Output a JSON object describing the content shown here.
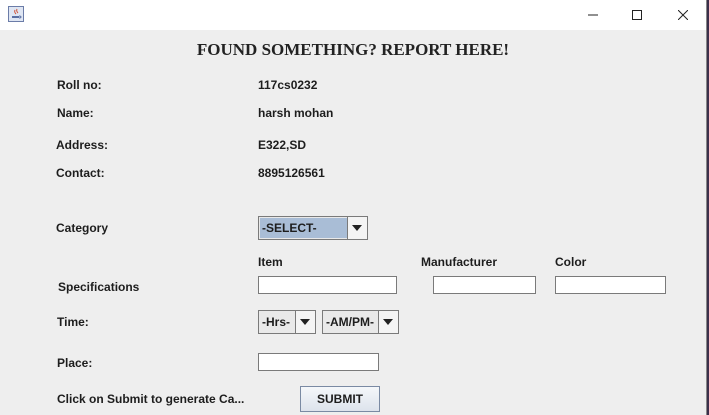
{
  "window": {
    "heading": "FOUND SOMETHING? REPORT HERE!"
  },
  "info": {
    "roll_label": "Roll no:",
    "roll_value": "117cs0232",
    "name_label": "Name:",
    "name_value": "harsh mohan",
    "address_label": "Address:",
    "address_value": "E322,SD",
    "contact_label": "Contact:",
    "contact_value": "8895126561"
  },
  "form": {
    "category_label": "Category",
    "category_selected": "-SELECT-",
    "item_header": "Item",
    "manufacturer_header": "Manufacturer",
    "color_header": "Color",
    "specifications_label": "Specifications",
    "item_value": "",
    "manufacturer_value": "",
    "color_value": "",
    "time_label": "Time:",
    "hrs_selected": "-Hrs-",
    "ampm_selected": "-AM/PM-",
    "place_label": "Place:",
    "place_value": "",
    "hint_text": "Click on Submit to generate Ca...",
    "submit_label": "SUBMIT"
  }
}
